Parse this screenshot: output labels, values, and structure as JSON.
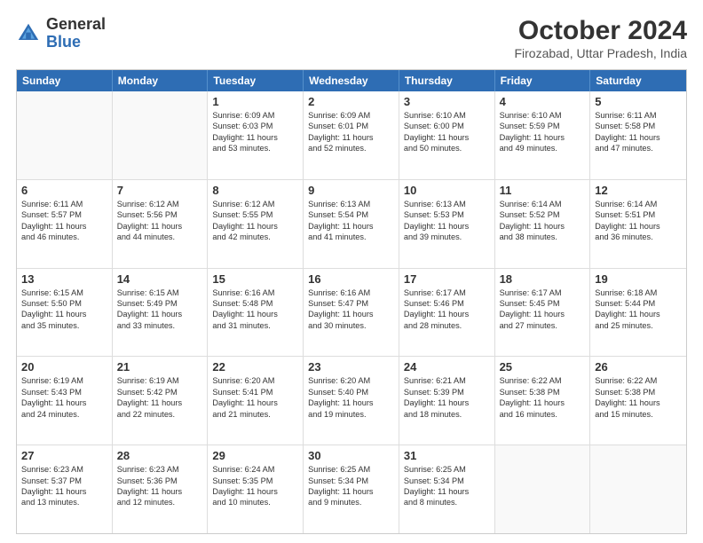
{
  "logo": {
    "general": "General",
    "blue": "Blue"
  },
  "title": "October 2024",
  "subtitle": "Firozabad, Uttar Pradesh, India",
  "header_days": [
    "Sunday",
    "Monday",
    "Tuesday",
    "Wednesday",
    "Thursday",
    "Friday",
    "Saturday"
  ],
  "weeks": [
    [
      {
        "day": "",
        "sunrise": "",
        "sunset": "",
        "daylight": ""
      },
      {
        "day": "",
        "sunrise": "",
        "sunset": "",
        "daylight": ""
      },
      {
        "day": "1",
        "sunrise": "Sunrise: 6:09 AM",
        "sunset": "Sunset: 6:03 PM",
        "daylight": "Daylight: 11 hours and 53 minutes."
      },
      {
        "day": "2",
        "sunrise": "Sunrise: 6:09 AM",
        "sunset": "Sunset: 6:01 PM",
        "daylight": "Daylight: 11 hours and 52 minutes."
      },
      {
        "day": "3",
        "sunrise": "Sunrise: 6:10 AM",
        "sunset": "Sunset: 6:00 PM",
        "daylight": "Daylight: 11 hours and 50 minutes."
      },
      {
        "day": "4",
        "sunrise": "Sunrise: 6:10 AM",
        "sunset": "Sunset: 5:59 PM",
        "daylight": "Daylight: 11 hours and 49 minutes."
      },
      {
        "day": "5",
        "sunrise": "Sunrise: 6:11 AM",
        "sunset": "Sunset: 5:58 PM",
        "daylight": "Daylight: 11 hours and 47 minutes."
      }
    ],
    [
      {
        "day": "6",
        "sunrise": "Sunrise: 6:11 AM",
        "sunset": "Sunset: 5:57 PM",
        "daylight": "Daylight: 11 hours and 46 minutes."
      },
      {
        "day": "7",
        "sunrise": "Sunrise: 6:12 AM",
        "sunset": "Sunset: 5:56 PM",
        "daylight": "Daylight: 11 hours and 44 minutes."
      },
      {
        "day": "8",
        "sunrise": "Sunrise: 6:12 AM",
        "sunset": "Sunset: 5:55 PM",
        "daylight": "Daylight: 11 hours and 42 minutes."
      },
      {
        "day": "9",
        "sunrise": "Sunrise: 6:13 AM",
        "sunset": "Sunset: 5:54 PM",
        "daylight": "Daylight: 11 hours and 41 minutes."
      },
      {
        "day": "10",
        "sunrise": "Sunrise: 6:13 AM",
        "sunset": "Sunset: 5:53 PM",
        "daylight": "Daylight: 11 hours and 39 minutes."
      },
      {
        "day": "11",
        "sunrise": "Sunrise: 6:14 AM",
        "sunset": "Sunset: 5:52 PM",
        "daylight": "Daylight: 11 hours and 38 minutes."
      },
      {
        "day": "12",
        "sunrise": "Sunrise: 6:14 AM",
        "sunset": "Sunset: 5:51 PM",
        "daylight": "Daylight: 11 hours and 36 minutes."
      }
    ],
    [
      {
        "day": "13",
        "sunrise": "Sunrise: 6:15 AM",
        "sunset": "Sunset: 5:50 PM",
        "daylight": "Daylight: 11 hours and 35 minutes."
      },
      {
        "day": "14",
        "sunrise": "Sunrise: 6:15 AM",
        "sunset": "Sunset: 5:49 PM",
        "daylight": "Daylight: 11 hours and 33 minutes."
      },
      {
        "day": "15",
        "sunrise": "Sunrise: 6:16 AM",
        "sunset": "Sunset: 5:48 PM",
        "daylight": "Daylight: 11 hours and 31 minutes."
      },
      {
        "day": "16",
        "sunrise": "Sunrise: 6:16 AM",
        "sunset": "Sunset: 5:47 PM",
        "daylight": "Daylight: 11 hours and 30 minutes."
      },
      {
        "day": "17",
        "sunrise": "Sunrise: 6:17 AM",
        "sunset": "Sunset: 5:46 PM",
        "daylight": "Daylight: 11 hours and 28 minutes."
      },
      {
        "day": "18",
        "sunrise": "Sunrise: 6:17 AM",
        "sunset": "Sunset: 5:45 PM",
        "daylight": "Daylight: 11 hours and 27 minutes."
      },
      {
        "day": "19",
        "sunrise": "Sunrise: 6:18 AM",
        "sunset": "Sunset: 5:44 PM",
        "daylight": "Daylight: 11 hours and 25 minutes."
      }
    ],
    [
      {
        "day": "20",
        "sunrise": "Sunrise: 6:19 AM",
        "sunset": "Sunset: 5:43 PM",
        "daylight": "Daylight: 11 hours and 24 minutes."
      },
      {
        "day": "21",
        "sunrise": "Sunrise: 6:19 AM",
        "sunset": "Sunset: 5:42 PM",
        "daylight": "Daylight: 11 hours and 22 minutes."
      },
      {
        "day": "22",
        "sunrise": "Sunrise: 6:20 AM",
        "sunset": "Sunset: 5:41 PM",
        "daylight": "Daylight: 11 hours and 21 minutes."
      },
      {
        "day": "23",
        "sunrise": "Sunrise: 6:20 AM",
        "sunset": "Sunset: 5:40 PM",
        "daylight": "Daylight: 11 hours and 19 minutes."
      },
      {
        "day": "24",
        "sunrise": "Sunrise: 6:21 AM",
        "sunset": "Sunset: 5:39 PM",
        "daylight": "Daylight: 11 hours and 18 minutes."
      },
      {
        "day": "25",
        "sunrise": "Sunrise: 6:22 AM",
        "sunset": "Sunset: 5:38 PM",
        "daylight": "Daylight: 11 hours and 16 minutes."
      },
      {
        "day": "26",
        "sunrise": "Sunrise: 6:22 AM",
        "sunset": "Sunset: 5:38 PM",
        "daylight": "Daylight: 11 hours and 15 minutes."
      }
    ],
    [
      {
        "day": "27",
        "sunrise": "Sunrise: 6:23 AM",
        "sunset": "Sunset: 5:37 PM",
        "daylight": "Daylight: 11 hours and 13 minutes."
      },
      {
        "day": "28",
        "sunrise": "Sunrise: 6:23 AM",
        "sunset": "Sunset: 5:36 PM",
        "daylight": "Daylight: 11 hours and 12 minutes."
      },
      {
        "day": "29",
        "sunrise": "Sunrise: 6:24 AM",
        "sunset": "Sunset: 5:35 PM",
        "daylight": "Daylight: 11 hours and 10 minutes."
      },
      {
        "day": "30",
        "sunrise": "Sunrise: 6:25 AM",
        "sunset": "Sunset: 5:34 PM",
        "daylight": "Daylight: 11 hours and 9 minutes."
      },
      {
        "day": "31",
        "sunrise": "Sunrise: 6:25 AM",
        "sunset": "Sunset: 5:34 PM",
        "daylight": "Daylight: 11 hours and 8 minutes."
      },
      {
        "day": "",
        "sunrise": "",
        "sunset": "",
        "daylight": ""
      },
      {
        "day": "",
        "sunrise": "",
        "sunset": "",
        "daylight": ""
      }
    ]
  ]
}
